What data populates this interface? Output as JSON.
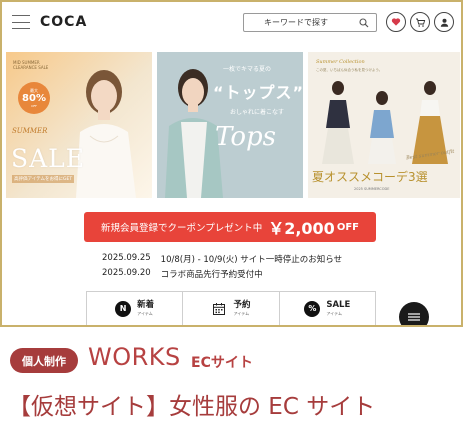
{
  "header": {
    "logo": "COCA",
    "search_placeholder": "キーワードで探す"
  },
  "banners": {
    "sale": {
      "tiny_lines": "MID SUMMER\nCLEARANCE\nSALE",
      "badge_top": "最大",
      "badge_value": "80%",
      "badge_bottom": "OFF",
      "summer": "SUMMER",
      "sale": "SALE",
      "sub": "高評価アイテムをお得にGET"
    },
    "tops": {
      "c1": "一枚でキマる夏の",
      "c2": "“トップス”",
      "c3": "おしゃれに着こなす",
      "c4": "Tops"
    },
    "coord": {
      "t1": "Summer Collection",
      "t2": "この夏、いちばん似合う私を見つけよう。",
      "t3": "Best summer outfit",
      "t4": "夏オススメコーデ3選",
      "t5": "2025 SUMMERCODE"
    }
  },
  "coupon": {
    "text": "新規会員登録でクーポンプレゼント中",
    "amount": "￥2,000",
    "off": "OFF"
  },
  "news": [
    {
      "date": "2025.09.25",
      "text": "10/8(月) - 10/9(火) サイト一時停止のお知らせ"
    },
    {
      "date": "2025.09.20",
      "text": "コラボ商品先行予約受付中"
    }
  ],
  "categories": [
    {
      "label": "新着",
      "sub": "アイテム",
      "icon": "N"
    },
    {
      "label": "予約",
      "sub": "アイテム",
      "icon": "calendar-icon"
    },
    {
      "label": "SALE",
      "sub": "アイテム",
      "icon": "%"
    }
  ],
  "caption": {
    "tag": "個人制作",
    "works": "WORKS",
    "works_sub": "ECサイト",
    "title": "【仮想サイト】女性服の EC サイト"
  },
  "colors": {
    "frame": "#c9b16b",
    "coupon": "#e8443a",
    "accent": "#a63c3c"
  }
}
